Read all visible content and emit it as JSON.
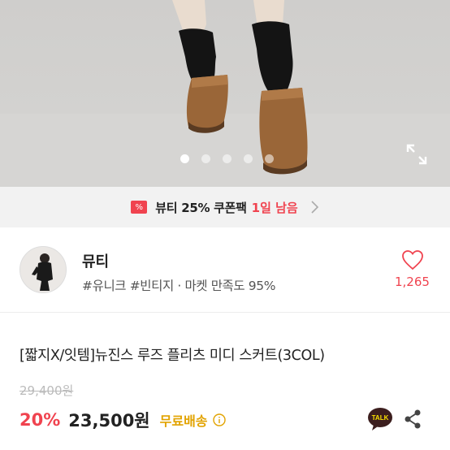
{
  "gallery": {
    "slide_count": 5,
    "active_slide": 1
  },
  "coupon": {
    "badge_symbol": "%",
    "text": "뷰티 25% 쿠폰팩",
    "remaining": "1일 남음"
  },
  "seller": {
    "name": "뮤티",
    "tags": "#유니크 #빈티지 · 마켓 만족도 95%",
    "likes": "1,265"
  },
  "product": {
    "title": "[짧지X/잇템]뉴진스 루즈 플리츠 미디 스커트(3COL)",
    "original_price": "29,400원",
    "discount": "20%",
    "price": "23,500원",
    "shipping": "무료배송"
  },
  "icons": {
    "talk_label": "TALK"
  },
  "colors": {
    "accent": "#f0434f",
    "shipping": "#e2a300",
    "coupon_bg": "#f2f2f2"
  }
}
